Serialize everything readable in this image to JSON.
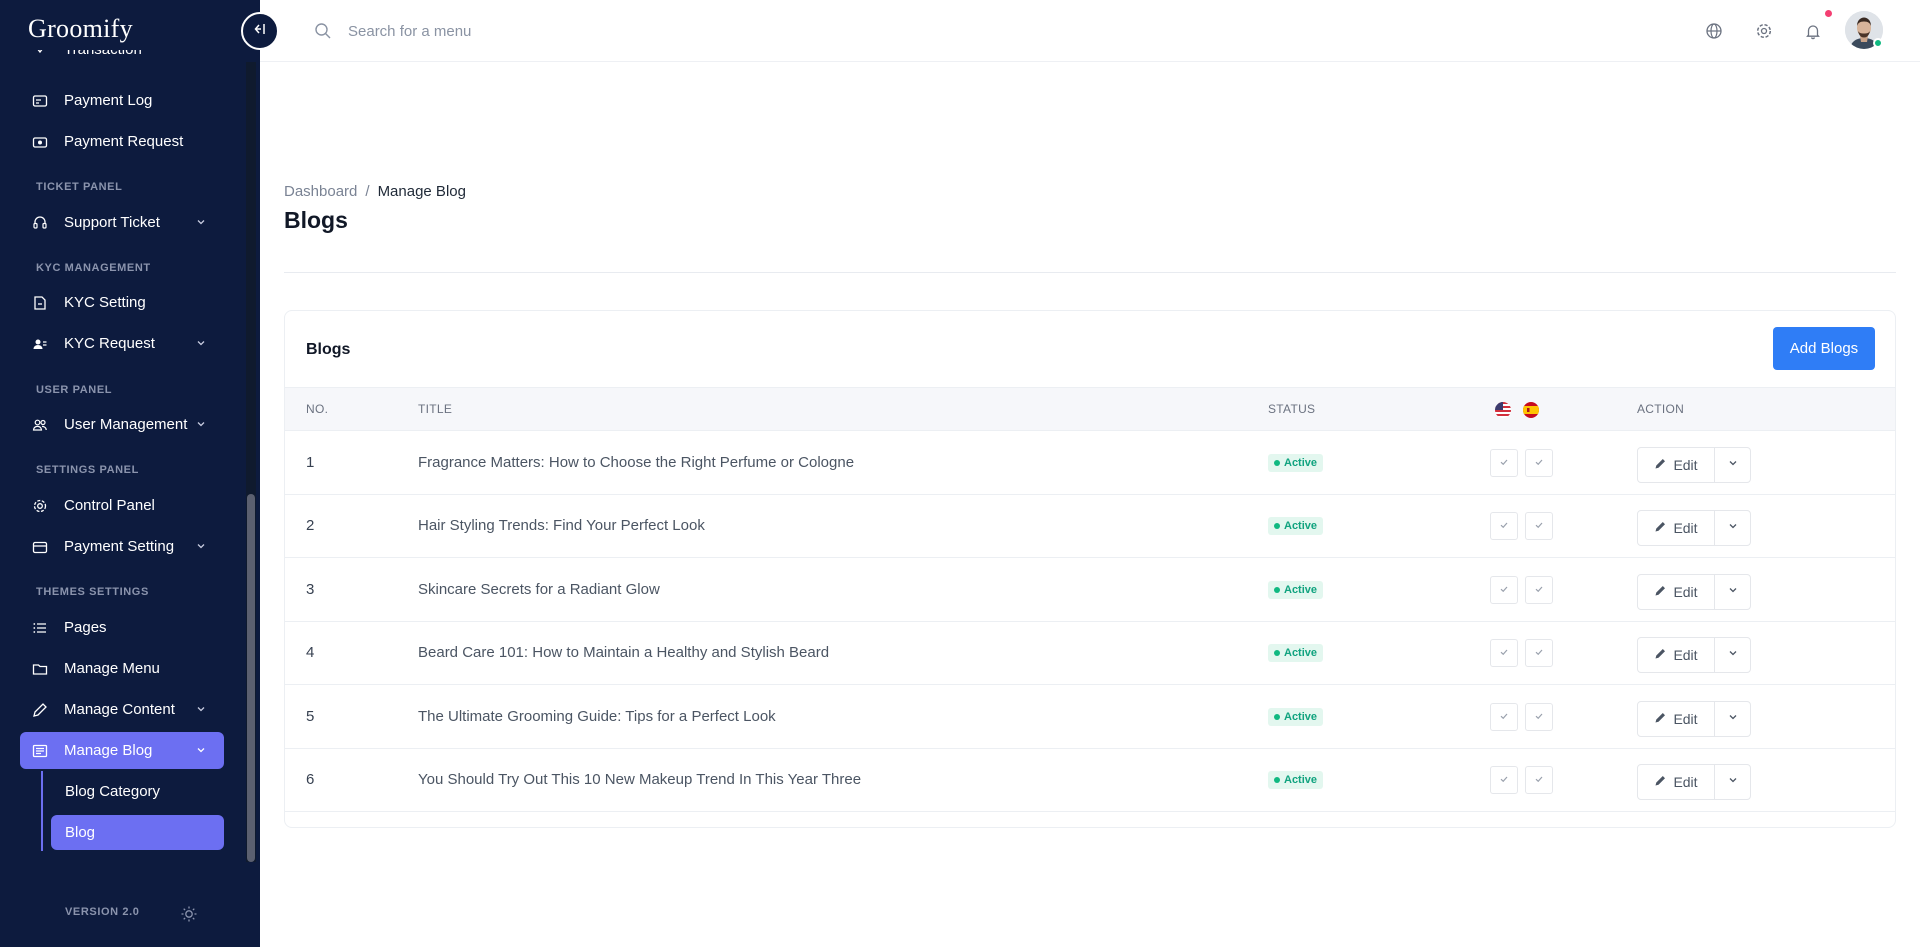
{
  "app": {
    "logo": "Groomify"
  },
  "sidebar": {
    "items": [
      {
        "label": "Transaction",
        "icon": "chevron-icon"
      },
      {
        "label": "Payment Log",
        "icon": "receipt-icon"
      },
      {
        "label": "Payment Request",
        "icon": "cash-icon"
      },
      {
        "label": "Support Ticket",
        "icon": "headset-icon",
        "has_children": true
      },
      {
        "label": "KYC Setting",
        "icon": "document-icon"
      },
      {
        "label": "KYC Request",
        "icon": "id-card-icon",
        "has_children": true
      },
      {
        "label": "User Management",
        "icon": "users-icon",
        "has_children": true
      },
      {
        "label": "Control Panel",
        "icon": "gear-icon"
      },
      {
        "label": "Payment Setting",
        "icon": "wallet-icon",
        "has_children": true
      },
      {
        "label": "Pages",
        "icon": "list-icon"
      },
      {
        "label": "Manage Menu",
        "icon": "folder-icon"
      },
      {
        "label": "Manage Content",
        "icon": "pencil-icon",
        "has_children": true
      },
      {
        "label": "Manage Blog",
        "icon": "newspaper-icon",
        "has_children": true,
        "active": true
      }
    ],
    "sections": [
      "TICKET PANEL",
      "KYC MANAGEMENT",
      "USER PANEL",
      "SETTINGS PANEL",
      "THEMES SETTINGS"
    ],
    "subitems": [
      {
        "label": "Blog Category"
      },
      {
        "label": "Blog",
        "active": true
      }
    ],
    "version": "VERSION 2.0"
  },
  "topbar": {
    "search_placeholder": "Search for a menu",
    "icons": [
      "globe-icon",
      "gear-icon",
      "bell-icon"
    ]
  },
  "breadcrumb": {
    "home": "Dashboard",
    "separator": "/",
    "current": "Manage Blog"
  },
  "page_title": "Blogs",
  "card": {
    "title": "Blogs",
    "add_button": "Add Blogs",
    "columns": {
      "no": "NO.",
      "title": "TITLE",
      "status": "STATUS",
      "action": "ACTION"
    },
    "language_flags": [
      "us-flag-icon",
      "spain-flag-icon"
    ],
    "rows": [
      {
        "no": "1",
        "title": "Fragrance Matters: How to Choose the Right Perfume or Cologne",
        "status": "Active",
        "edit": "Edit"
      },
      {
        "no": "2",
        "title": "Hair Styling Trends: Find Your Perfect Look",
        "status": "Active",
        "edit": "Edit"
      },
      {
        "no": "3",
        "title": "Skincare Secrets for a Radiant Glow",
        "status": "Active",
        "edit": "Edit"
      },
      {
        "no": "4",
        "title": "Beard Care 101: How to Maintain a Healthy and Stylish Beard",
        "status": "Active",
        "edit": "Edit"
      },
      {
        "no": "5",
        "title": "The Ultimate Grooming Guide: Tips for a Perfect Look",
        "status": "Active",
        "edit": "Edit"
      },
      {
        "no": "6",
        "title": "You Should Try Out This 10 New Makeup Trend In This Year Three",
        "status": "Active",
        "edit": "Edit"
      }
    ]
  },
  "colors": {
    "sidebar_bg": "#0d1b3e",
    "accent": "#6c6ff2",
    "primary_button": "#2f7df6",
    "status_active": "#10a37f"
  }
}
